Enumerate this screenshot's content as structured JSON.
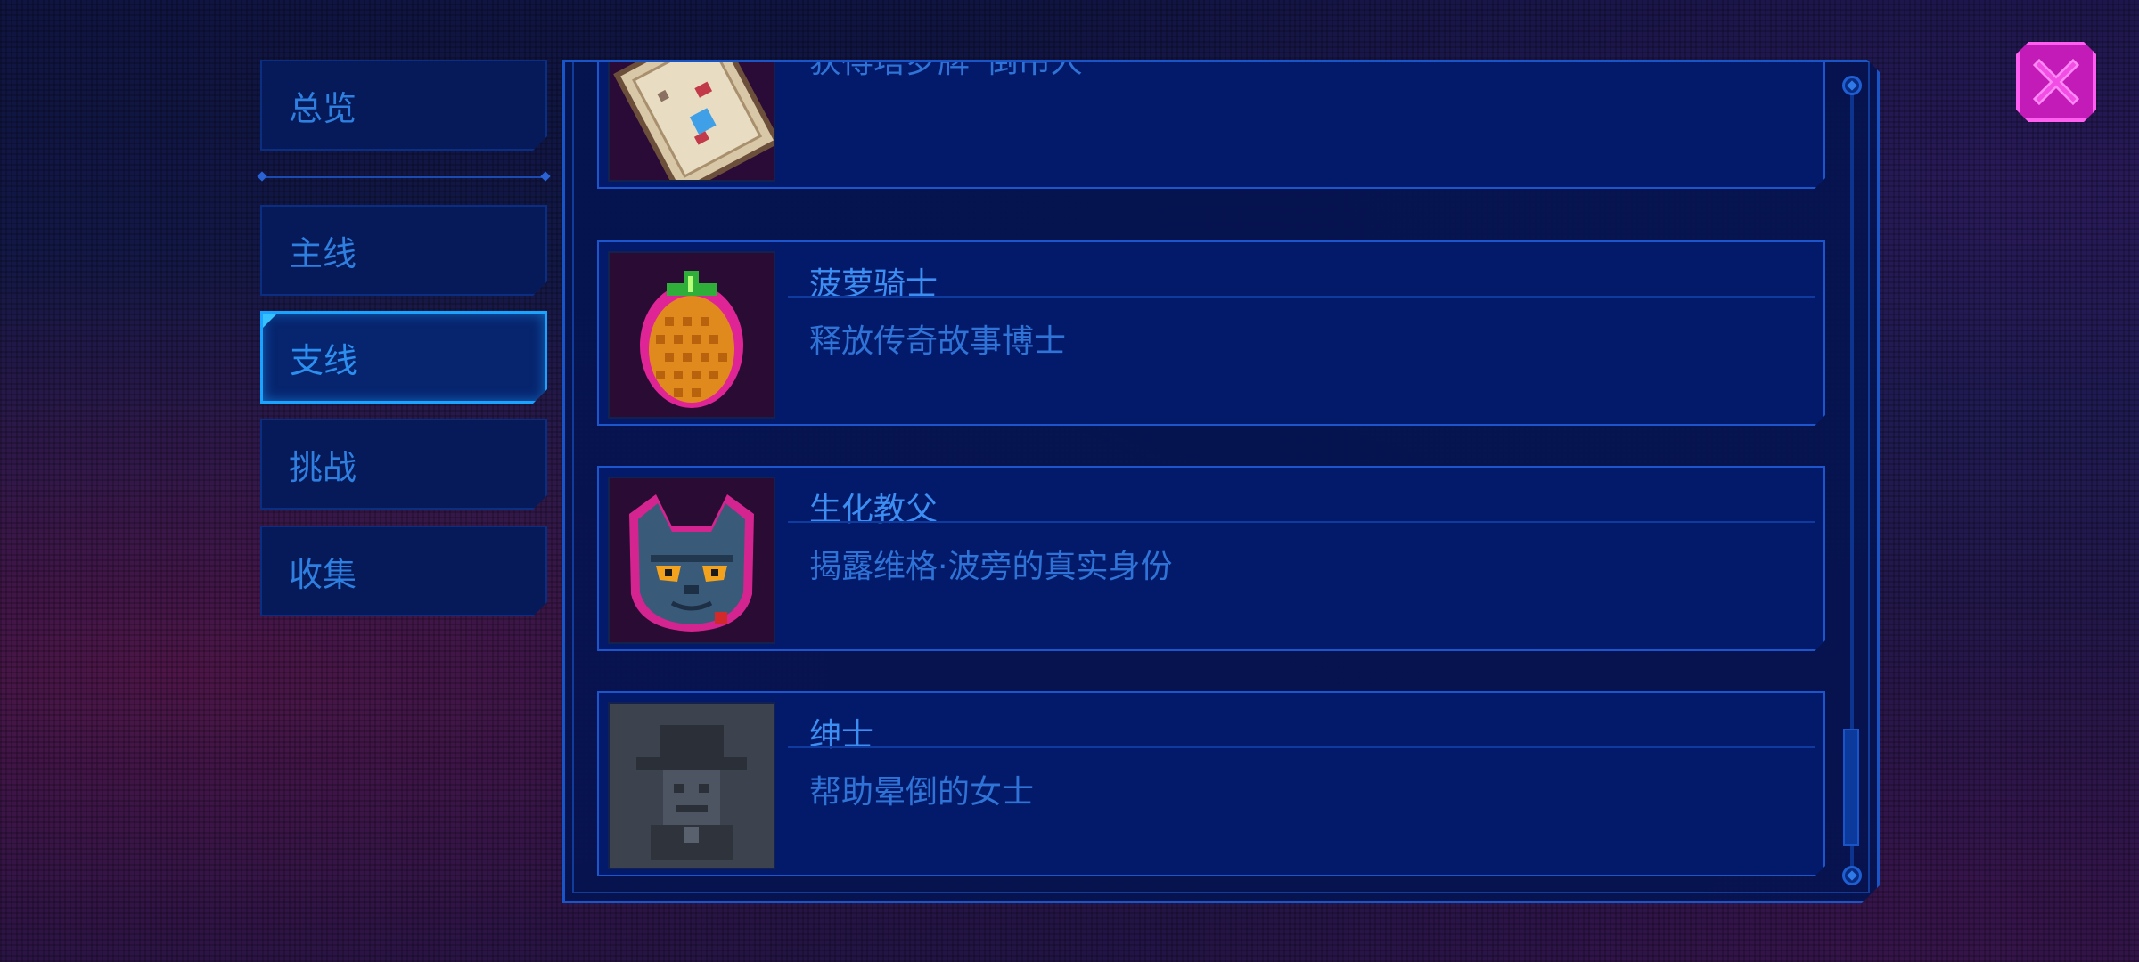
{
  "tabs": [
    {
      "label": "总览",
      "active": false
    },
    {
      "label": "主线",
      "active": false
    },
    {
      "label": "支线",
      "active": true
    },
    {
      "label": "挑战",
      "active": false
    },
    {
      "label": "收集",
      "active": false
    }
  ],
  "entries": [
    {
      "name": "",
      "description": "获得塔罗牌“倒吊人”",
      "icon": "tarot-card-icon",
      "unlocked": true
    },
    {
      "name": "菠萝骑士",
      "description": "释放传奇故事博士",
      "icon": "pineapple-icon",
      "unlocked": true
    },
    {
      "name": "生化教父",
      "description": "揭露维格·波旁的真实身份",
      "icon": "cat-godfather-icon",
      "unlocked": true
    },
    {
      "name": "绅士",
      "description": "帮助晕倒的女士",
      "icon": "gentleman-icon",
      "unlocked": false
    }
  ],
  "colors": {
    "accent": "#1aa3ff",
    "text": "#3d8ef2",
    "close": "#c21bb8"
  },
  "scroll": {
    "position": 1.0
  }
}
